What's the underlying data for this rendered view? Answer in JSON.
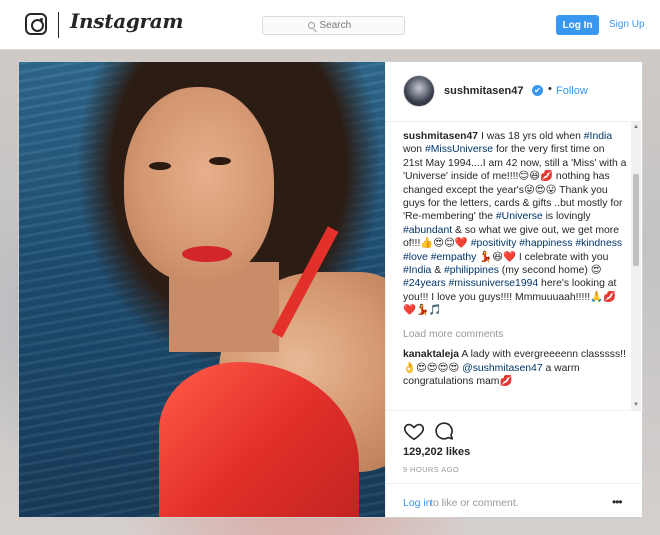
{
  "topbar": {
    "brand": "Instagram",
    "search_placeholder": "Search",
    "login_label": "Log In",
    "signup_label": "Sign Up"
  },
  "post": {
    "username": "sushmitasen47",
    "verified_badge": "✔",
    "separator": "•",
    "follow_label": "Follow",
    "caption_segments": [
      {
        "text": "sushmitasen47",
        "type": "user"
      },
      {
        "text": " I was 18 yrs old when ",
        "type": "text"
      },
      {
        "text": "#India",
        "type": "tag"
      },
      {
        "text": " won ",
        "type": "text"
      },
      {
        "text": "#MissUniverse",
        "type": "tag"
      },
      {
        "text": " for the very first time on 21st May 1994....I am 42 now, still a 'Miss' with a 'Universe' inside of me!!!!😊😆💋 nothing has changed except the year's😜😍😛 Thank you guys for the letters, cards & gifts ..but mostly for 'Re-membering' the ",
        "type": "text"
      },
      {
        "text": "#Universe",
        "type": "tag"
      },
      {
        "text": " is lovingly ",
        "type": "text"
      },
      {
        "text": "#abundant",
        "type": "tag"
      },
      {
        "text": " & so what we give out, we get more of!!!👍😍😊❤️ ",
        "type": "text"
      },
      {
        "text": "#positivity",
        "type": "tag"
      },
      {
        "text": " ",
        "type": "text"
      },
      {
        "text": "#happiness",
        "type": "tag"
      },
      {
        "text": " ",
        "type": "text"
      },
      {
        "text": "#kindness",
        "type": "tag"
      },
      {
        "text": " ",
        "type": "text"
      },
      {
        "text": "#love",
        "type": "tag"
      },
      {
        "text": " ",
        "type": "text"
      },
      {
        "text": "#empathy",
        "type": "tag"
      },
      {
        "text": " 💃😆❤️ I celebrate with you ",
        "type": "text"
      },
      {
        "text": "#India",
        "type": "tag"
      },
      {
        "text": " & ",
        "type": "text"
      },
      {
        "text": "#philippines",
        "type": "tag"
      },
      {
        "text": " (my second home) 😍 ",
        "type": "text"
      },
      {
        "text": "#24years",
        "type": "tag"
      },
      {
        "text": " ",
        "type": "text"
      },
      {
        "text": "#missuniverse1994",
        "type": "tag"
      },
      {
        "text": " here's looking at you!!! I love you guys!!!! Mmmuuuaah!!!!!🙏💋❤️💃🎵",
        "type": "text"
      }
    ],
    "load_more_label": "Load more comments",
    "comment2_segments": [
      {
        "text": "kanaktaleja",
        "type": "user"
      },
      {
        "text": " A lady with evergreeeenn classsss!!👌😍😍😍😍 ",
        "type": "text"
      },
      {
        "text": "@sushmitasen47",
        "type": "tag"
      },
      {
        "text": " a warm congratulations mam💋",
        "type": "text"
      }
    ],
    "likes": "129,202 likes",
    "time_ago": "9 HOURS AGO",
    "login_link": "Log in",
    "login_rest": " to like or comment.",
    "more_glyph": "•••"
  },
  "icons": {
    "heart": "heart-icon",
    "comment": "comment-icon",
    "more": "more-options-icon",
    "search": "search-icon",
    "camera": "instagram-glyph-icon"
  },
  "colors": {
    "accent": "#3897f0",
    "hashtag": "#003569",
    "text": "#262626",
    "muted": "#999999"
  }
}
